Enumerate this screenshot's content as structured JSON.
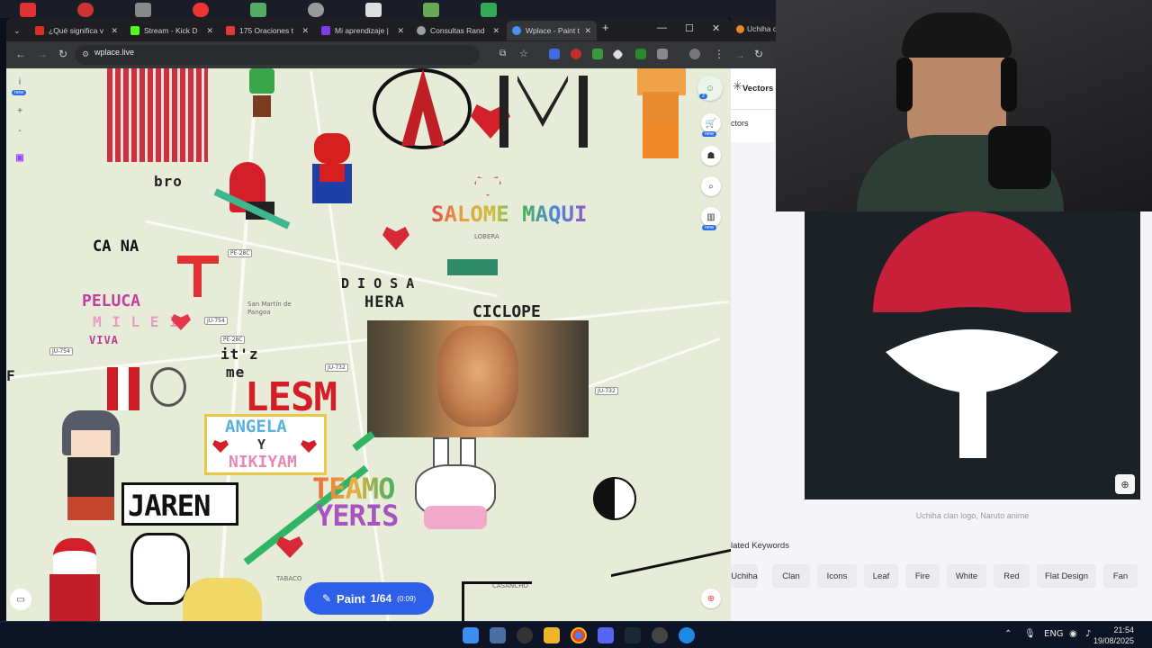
{
  "browser": {
    "tabs": [
      {
        "label": "¿Qué significa v",
        "color": "#d93025"
      },
      {
        "label": "Stream - Kick D",
        "color": "#53fc18"
      },
      {
        "label": "175 Oraciones t",
        "color": "#e53935"
      },
      {
        "label": "Mi aprendizaje |",
        "color": "#7b3fe4"
      },
      {
        "label": "Consultas Rand",
        "color": "#9aa0a6"
      },
      {
        "label": "Wplace - Paint t",
        "color": "#4f8ef7"
      }
    ],
    "new_tab": "+",
    "url": "wplace.live",
    "second_window_tab": "Uchiha cl"
  },
  "map": {
    "road_labels": [
      "PE-28C",
      "JU-754",
      "JU-754",
      "JU-732",
      "JU-732",
      "PE-28C"
    ],
    "place_labels": [
      "San Martín de Pangoa",
      "LOBERA",
      "TABACO",
      "CASANCHO"
    ],
    "pixel_texts": {
      "bro": "bro",
      "cana": "CA NA",
      "peluca": "PELUCA",
      "milei": "M I L E I",
      "viva": "VIVA",
      "itz": "it'z",
      "me": "me",
      "lesm": "LESM",
      "angela": "ANGELA",
      "y": "Y",
      "nikiyam": "NIKIYAM",
      "jaren": "JAREN",
      "diosa": "D I O S A",
      "hera": "HERA",
      "ciclope": "CICLOPE",
      "salome": "SALOME MAQUI",
      "teamo": "TEAMO",
      "yeris": "YERIS",
      "f": "F"
    }
  },
  "controls": {
    "info_label": "i",
    "new_badge": "new",
    "zoom_in": "+",
    "zoom_out": "-",
    "paint_label": "Paint",
    "paint_count": "1/64",
    "paint_timer": "(0:09)",
    "badge_count": "2"
  },
  "side_page": {
    "nav_vectors": "Vectors",
    "nav_vectors2": "ctors",
    "caption": "Uchiha clan logo, Naruto anime",
    "related_title": "lated Keywords",
    "keywords": [
      "Uchiha",
      "Clan",
      "Icons",
      "Leaf",
      "Fire",
      "White",
      "Red",
      "Flat Design",
      "Fan"
    ]
  },
  "taskbar": {
    "lang": "ENG",
    "time": "21:54",
    "date": "19/08/2025"
  }
}
